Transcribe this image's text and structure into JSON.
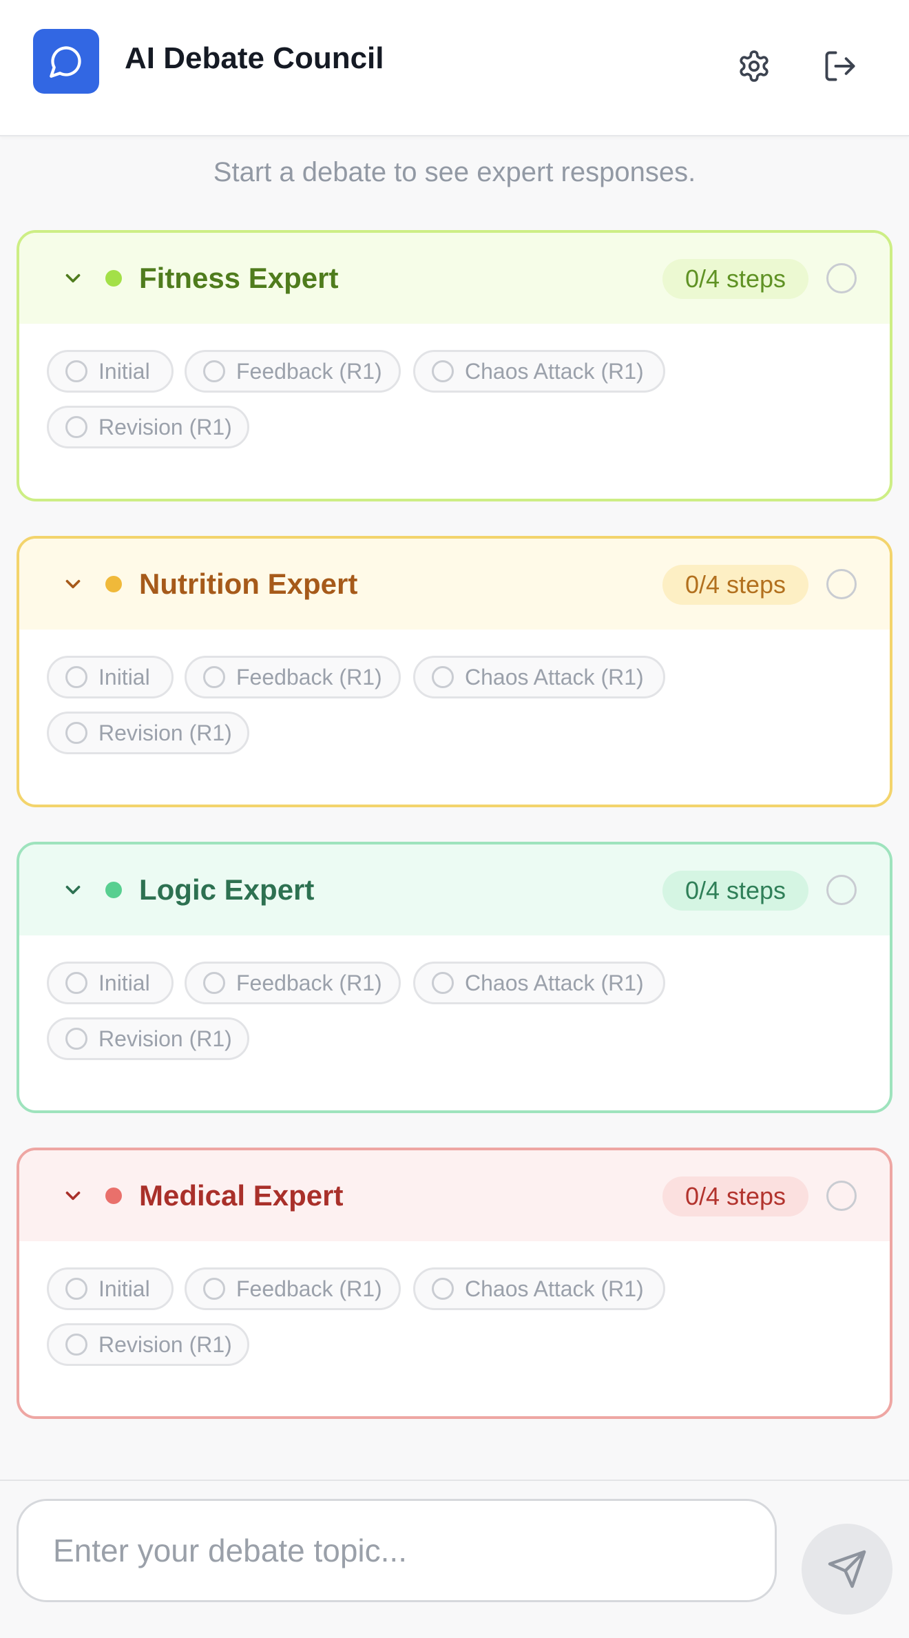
{
  "app": {
    "title": "AI Debate Council"
  },
  "hint": "Start a debate to see expert responses.",
  "experts": [
    {
      "name": "Fitness Expert",
      "steps": "0/4 steps",
      "accent": "#a3e048",
      "border": "#cdee85",
      "head_bg": "#f6fde8",
      "text": "#4f7c1d",
      "badge_bg": "#ecf9d2",
      "badge_text": "#5f9224",
      "chips": [
        "Initial",
        "Feedback (R1)",
        "Chaos Attack (R1)",
        "Revision (R1)"
      ]
    },
    {
      "name": "Nutrition Expert",
      "steps": "0/4 steps",
      "accent": "#f0b93a",
      "border": "#f3d46c",
      "head_bg": "#fffae8",
      "text": "#a65a1a",
      "badge_bg": "#fdefc4",
      "badge_text": "#b2701e",
      "chips": [
        "Initial",
        "Feedback (R1)",
        "Chaos Attack (R1)",
        "Revision (R1)"
      ]
    },
    {
      "name": "Logic Expert",
      "steps": "0/4 steps",
      "accent": "#58cf90",
      "border": "#9ee3bd",
      "head_bg": "#ecfbf3",
      "text": "#2d7151",
      "badge_bg": "#d5f5e3",
      "badge_text": "#2f7f58",
      "chips": [
        "Initial",
        "Feedback (R1)",
        "Chaos Attack (R1)",
        "Revision (R1)"
      ]
    },
    {
      "name": "Medical Expert",
      "steps": "0/4 steps",
      "accent": "#e9706b",
      "border": "#eea6a3",
      "head_bg": "#fdf1f1",
      "text": "#a9302a",
      "badge_bg": "#fbe0df",
      "badge_text": "#b2332d",
      "chips": [
        "Initial",
        "Feedback (R1)",
        "Chaos Attack (R1)",
        "Revision (R1)"
      ]
    }
  ],
  "composer": {
    "placeholder": "Enter your debate topic..."
  },
  "icons": {
    "logo": "chat-bubble-icon",
    "settings": "gear-icon",
    "logout": "logout-icon",
    "collapse": "chevron-down-icon",
    "send": "send-icon"
  }
}
